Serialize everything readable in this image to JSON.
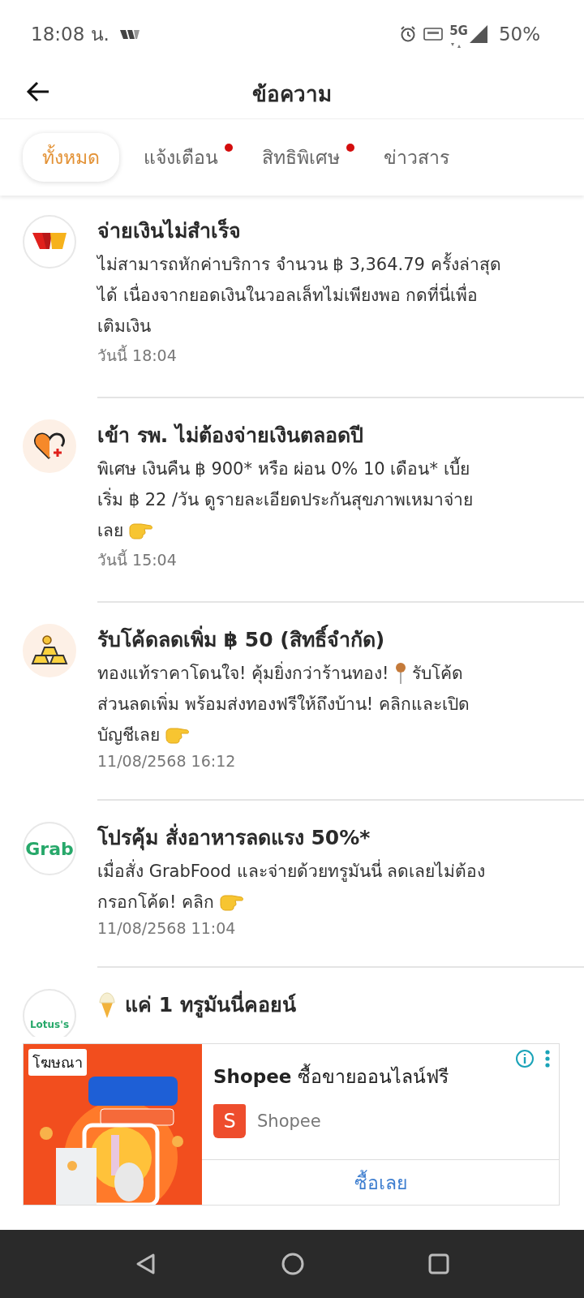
{
  "status_bar": {
    "time": "18:08 น.",
    "network": "5G",
    "battery": "50%"
  },
  "header": {
    "title": "ข้อความ"
  },
  "tabs": [
    {
      "label": "ทั้งหมด",
      "selected": true,
      "badge": false
    },
    {
      "label": "แจ้งเตือน",
      "selected": false,
      "badge": true
    },
    {
      "label": "สิทธิพิเศษ",
      "selected": false,
      "badge": true
    },
    {
      "label": "ข่าวสาร",
      "selected": false,
      "badge": false
    }
  ],
  "messages": [
    {
      "avatar": {
        "kind": "wallet"
      },
      "title": "จ่ายเงินไม่สำเร็จ",
      "lines": [
        [
          {
            "kind": "text",
            "text": "ไม่สามารถหักค่าบริการ จำนวน ฿ 3,364.79 ครั้งล่าสุด"
          }
        ],
        [
          {
            "kind": "text",
            "text": "ได้ เนื่องจากยอดเงินในวอลเล็ทไม่เพียงพอ กดที่นี่เพื่อ"
          }
        ],
        [
          {
            "kind": "text",
            "text": "เติมเงิน"
          }
        ]
      ],
      "time": "วันนี้ 18:04"
    },
    {
      "avatar": {
        "kind": "heart"
      },
      "title": "เข้า รพ. ไม่ต้องจ่ายเงินตลอดปี",
      "lines": [
        [
          {
            "kind": "text",
            "text": "พิเศษ เงินคืน ฿ 900* หรือ ผ่อน 0% 10 เดือน* เบี้ย"
          }
        ],
        [
          {
            "kind": "text",
            "text": "เริ่ม ฿ 22 /วัน ดูรายละเอียดประกันสุขภาพเหมาจ่าย"
          }
        ],
        [
          {
            "kind": "text",
            "text": "เลย"
          },
          {
            "kind": "hand"
          }
        ]
      ],
      "time": "วันนี้ 15:04"
    },
    {
      "avatar": {
        "kind": "gold"
      },
      "title": "รับโค้ดลดเพิ่ม ฿ 50 (สิทธิ์จำกัด)",
      "lines": [
        [
          {
            "kind": "text",
            "text": "ทองแท้ราคาโดนใจ! คุ้มยิ่งกว่าร้านทอง!"
          },
          {
            "kind": "pin"
          },
          {
            "kind": "text",
            "text": "รับโค้ด"
          }
        ],
        [
          {
            "kind": "text",
            "text": "ส่วนลดเพิ่ม พร้อมส่งทองฟรีให้ถึงบ้าน! คลิกและเปิด"
          }
        ],
        [
          {
            "kind": "text",
            "text": "บัญชีเลย"
          },
          {
            "kind": "hand"
          }
        ]
      ],
      "time": "11/08/2568 16:12"
    },
    {
      "avatar": {
        "kind": "text",
        "text": "Grab"
      },
      "title": "โปรคุ้ม สั่งอาหารลดแรง 50%*",
      "lines": [
        [
          {
            "kind": "text",
            "text": "เมื่อสั่ง GrabFood และจ่ายด้วยทรูมันนี่ ลดเลยไม่ต้อง"
          }
        ],
        [
          {
            "kind": "text",
            "text": "กรอกโค้ด! คลิก"
          },
          {
            "kind": "hand"
          }
        ]
      ],
      "time": "11/08/2568 11:04"
    },
    {
      "avatar": {
        "kind": "text",
        "text": "Lotus's"
      },
      "title_icon": {
        "kind": "ice-cream"
      },
      "title": "แค่ 1 ทรูมันนี่คอยน์"
    }
  ],
  "ad": {
    "label": "โฆษณา",
    "kind": "picture",
    "title": "**Shopee** ซื้อขายออนไลน์ฟรี",
    "advertiser": "Shopee",
    "advertiser_initial": "S",
    "cta": "ซื้อเลย"
  }
}
